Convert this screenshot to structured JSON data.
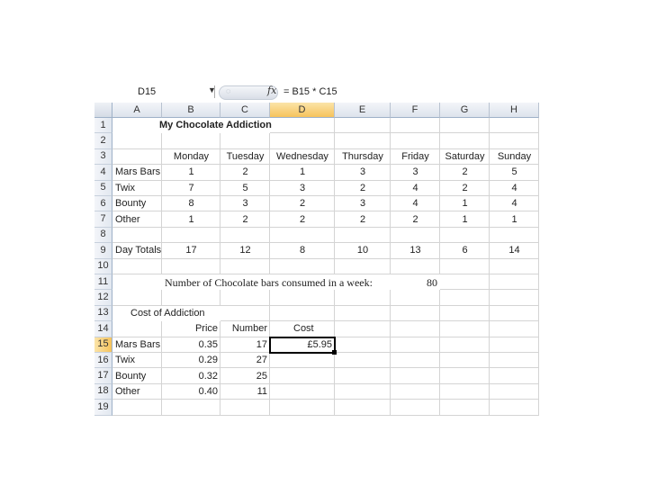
{
  "formula_bar": {
    "name_box": "D15",
    "fx_label": "fx",
    "formula": "= B15 * C15"
  },
  "columns": [
    "A",
    "B",
    "C",
    "D",
    "E",
    "F",
    "G",
    "H"
  ],
  "rows": [
    "1",
    "2",
    "3",
    "4",
    "5",
    "6",
    "7",
    "8",
    "9",
    "10",
    "11",
    "12",
    "13",
    "14",
    "15",
    "16",
    "17",
    "18",
    "19"
  ],
  "selection": {
    "column": "D",
    "row": "15"
  },
  "cells": {
    "title": "My Chocolate Addiction",
    "days": [
      "Monday",
      "Tuesday",
      "Wednesday",
      "Thursday",
      "Friday",
      "Saturday",
      "Sunday"
    ],
    "items": [
      {
        "name": "Mars Bars",
        "values": [
          "1",
          "2",
          "1",
          "3",
          "3",
          "2",
          "5"
        ]
      },
      {
        "name": "Twix",
        "values": [
          "7",
          "5",
          "3",
          "2",
          "4",
          "2",
          "4"
        ]
      },
      {
        "name": "Bounty",
        "values": [
          "8",
          "3",
          "2",
          "3",
          "4",
          "1",
          "4"
        ]
      },
      {
        "name": "Other",
        "values": [
          "1",
          "2",
          "2",
          "2",
          "2",
          "1",
          "1"
        ]
      }
    ],
    "totals_label": "Day Totals",
    "totals": [
      "17",
      "12",
      "8",
      "10",
      "13",
      "6",
      "14"
    ],
    "week_label": "Number of Chocolate bars consumed in a week:",
    "week_value": "80",
    "cost_title": "Cost of Addiction",
    "cost_headers": {
      "price": "Price",
      "number": "Number",
      "cost": "Cost"
    },
    "cost_rows": [
      {
        "name": "Mars Bars",
        "price": "0.35",
        "number": "17",
        "cost": "£5.95"
      },
      {
        "name": "Twix",
        "price": "0.29",
        "number": "27",
        "cost": ""
      },
      {
        "name": "Bounty",
        "price": "0.32",
        "number": "25",
        "cost": ""
      },
      {
        "name": "Other",
        "price": "0.40",
        "number": "11",
        "cost": ""
      }
    ]
  }
}
